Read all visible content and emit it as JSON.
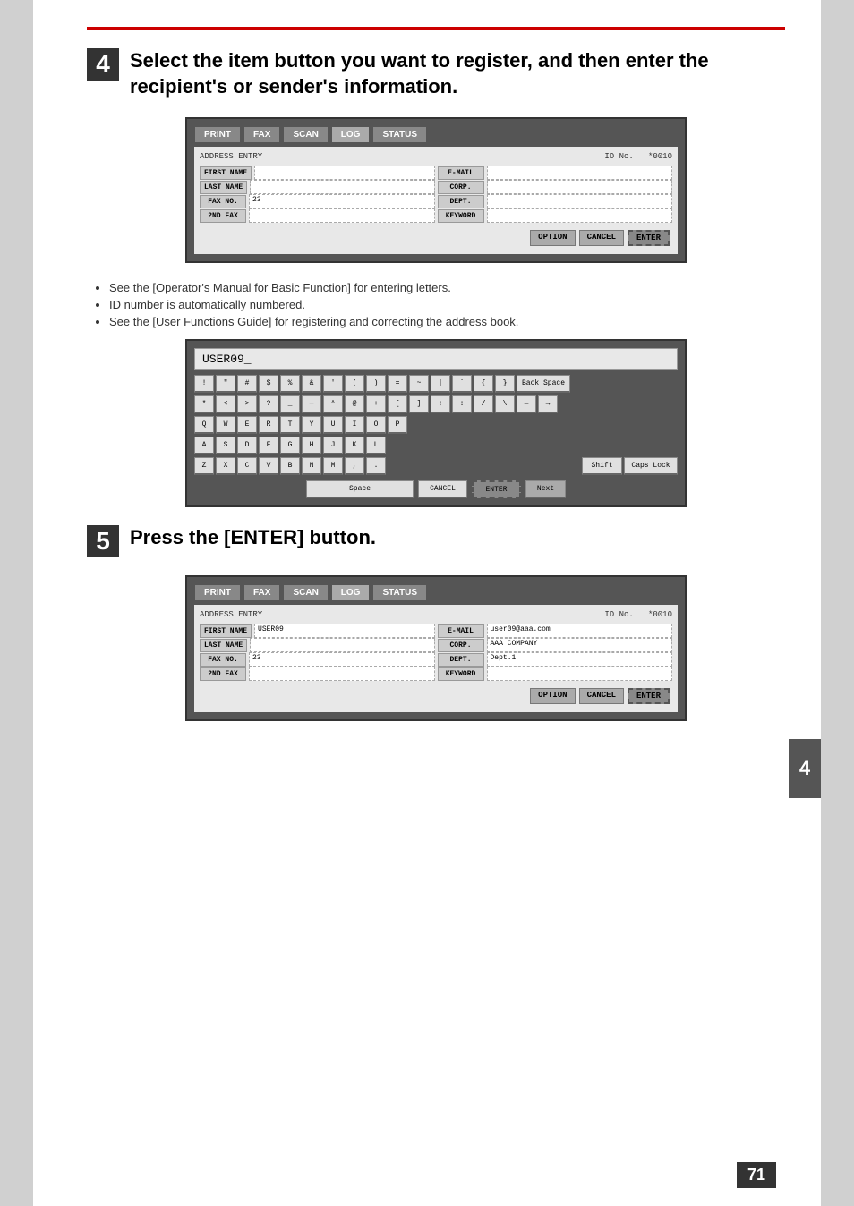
{
  "page": {
    "background_color": "#d0d0d0",
    "page_number": "71",
    "side_tab": "4"
  },
  "step4": {
    "number": "4",
    "heading": "Select the item button you want to register, and then enter the recipient's or sender's information."
  },
  "step5": {
    "number": "5",
    "heading": "Press the [ENTER] button."
  },
  "screen1": {
    "tabs": [
      "PRINT",
      "FAX",
      "SCAN",
      "LOG",
      "STATUS"
    ],
    "active_tab": "LOG",
    "header_left": "ADDRESS ENTRY",
    "header_right_label": "ID No.",
    "header_right_value": "*0010",
    "fields_left": [
      {
        "label": "FIRST NAME",
        "value": ""
      },
      {
        "label": "LAST NAME",
        "value": ""
      },
      {
        "label": "FAX NO.",
        "value": "23"
      },
      {
        "label": "2ND FAX",
        "value": ""
      }
    ],
    "fields_right": [
      {
        "label": "E-MAIL",
        "value": ""
      },
      {
        "label": "CORP.",
        "value": ""
      },
      {
        "label": "DEPT.",
        "value": ""
      },
      {
        "label": "KEYWORD",
        "value": ""
      }
    ],
    "buttons": [
      "OPTION",
      "CANCEL",
      "ENTER"
    ]
  },
  "bullets": [
    "See the [Operator's Manual for Basic Function] for entering letters.",
    "ID number is automatically numbered.",
    "See the [User Functions Guide] for registering and correcting the address book."
  ],
  "keyboard": {
    "display_text": "USER09_",
    "row1": [
      "!",
      "\"",
      "#",
      "$",
      "%",
      "&",
      "'",
      "(",
      ")",
      "=",
      "~",
      "|",
      "`",
      "{",
      "}"
    ],
    "row1_extra": "Back Space",
    "row2": [
      "*",
      "<",
      ">",
      "?",
      "_",
      "—",
      "^",
      "@",
      "+",
      "[",
      "]",
      ";",
      ":",
      "/",
      "\\",
      "←",
      "→"
    ],
    "row3": [
      "Q",
      "W",
      "E",
      "R",
      "T",
      "Y",
      "U",
      "I",
      "O",
      "P"
    ],
    "row4": [
      "A",
      "S",
      "D",
      "F",
      "G",
      "H",
      "J",
      "K",
      "L"
    ],
    "row5": [
      "Z",
      "X",
      "C",
      "V",
      "B",
      "N",
      "M",
      ",",
      "."
    ],
    "row5_extra": [
      "Shift",
      "Caps Lock"
    ],
    "bottom": [
      "Space",
      "CANCEL",
      "ENTER",
      "Next"
    ]
  },
  "screen2": {
    "tabs": [
      "PRINT",
      "FAX",
      "SCAN",
      "LOG",
      "STATUS"
    ],
    "active_tab": "LOG",
    "header_left": "ADDRESS ENTRY",
    "header_right_label": "ID No.",
    "header_right_value": "*0010",
    "fields_left": [
      {
        "label": "FIRST NAME",
        "value": "USER09"
      },
      {
        "label": "LAST NAME",
        "value": ""
      },
      {
        "label": "FAX NO.",
        "value": "23"
      },
      {
        "label": "2ND FAX",
        "value": ""
      }
    ],
    "fields_right": [
      {
        "label": "E-MAIL",
        "value": "user09@aaa.com"
      },
      {
        "label": "CORP.",
        "value": "AAA COMPANY"
      },
      {
        "label": "DEPT.",
        "value": "Dept.1"
      },
      {
        "label": "KEYWORD",
        "value": ""
      }
    ],
    "buttons": [
      "OPTION",
      "CANCEL",
      "ENTER"
    ]
  }
}
